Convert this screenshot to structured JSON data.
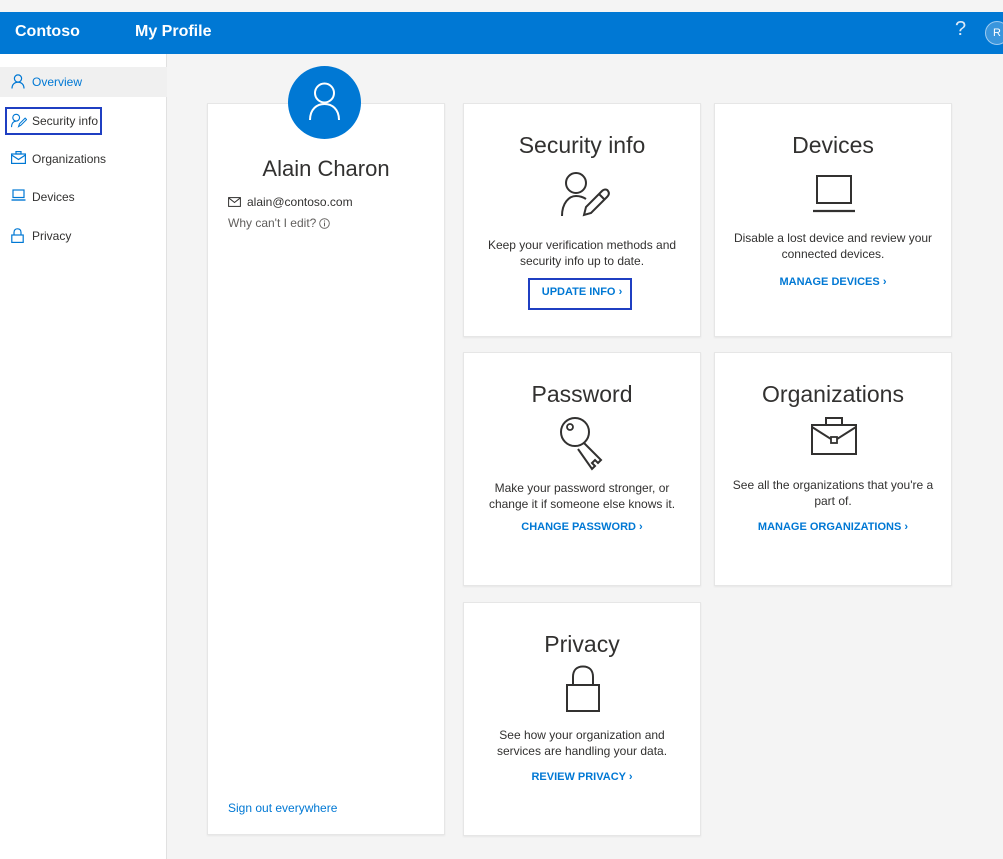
{
  "header": {
    "brand": "Contoso",
    "app_title": "My Profile",
    "help_glyph": "?",
    "avatar_initial": "R",
    "bar_color": "#0078d4"
  },
  "sidebar": {
    "items": [
      {
        "label": "Overview",
        "icon": "person-icon",
        "active": true
      },
      {
        "label": "Security info",
        "icon": "person-pen-icon",
        "highlighted": true
      },
      {
        "label": "Organizations",
        "icon": "briefcase-icon"
      },
      {
        "label": "Devices",
        "icon": "laptop-icon"
      },
      {
        "label": "Privacy",
        "icon": "lock-icon"
      }
    ]
  },
  "profile": {
    "name": "Alain Charon",
    "email": "alain@contoso.com",
    "cant_edit": "Why can't I edit?",
    "sign_out": "Sign out everywhere"
  },
  "cards": {
    "security": {
      "title": "Security info",
      "description": "Keep your verification methods and security info up to date.",
      "link": "UPDATE INFO",
      "icon": "person-pen-icon"
    },
    "devices": {
      "title": "Devices",
      "description": "Disable a lost device and review your connected devices.",
      "link": "MANAGE DEVICES",
      "icon": "laptop-icon"
    },
    "password": {
      "title": "Password",
      "description": "Make your password stronger, or change it if someone else knows it.",
      "link": "CHANGE PASSWORD",
      "icon": "key-icon"
    },
    "organizations": {
      "title": "Organizations",
      "description": "See all the organizations that you're a part of.",
      "link": "MANAGE ORGANIZATIONS",
      "icon": "briefcase-icon"
    },
    "privacy": {
      "title": "Privacy",
      "description": "See how your organization and services are handling your data.",
      "link": "REVIEW PRIVACY",
      "icon": "lock-icon"
    }
  },
  "colors": {
    "accent": "#0078d4",
    "highlight_frame": "#1f3fc2"
  }
}
